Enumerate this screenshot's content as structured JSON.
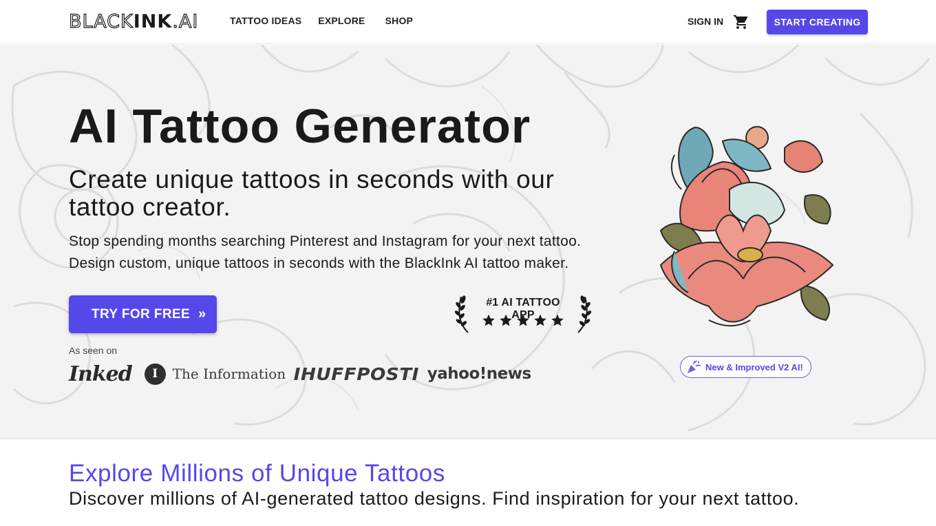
{
  "header": {
    "logo_light": "BLACK",
    "logo_bold": "INK",
    "logo_suffix": ".AI",
    "nav": [
      {
        "label": "TATTOO IDEAS"
      },
      {
        "label": "EXPLORE"
      },
      {
        "label": "SHOP"
      }
    ],
    "sign_in": "SIGN IN",
    "cart_icon": "shopping-cart-icon",
    "start_button": "START CREATING"
  },
  "hero": {
    "title": "AI Tattoo Generator",
    "subtitle": "Create unique tattoos in seconds with our tattoo creator.",
    "description_line1": "Stop spending months searching Pinterest and Instagram for your next tattoo.",
    "description_line2": "Design custom, unique tattoos in seconds with the BlackInk AI tattoo maker.",
    "try_button": "TRY FOR FREE",
    "try_button_icon": "double-chevron-right-icon",
    "seen_on": "As seen on",
    "press": {
      "inked": "Inked",
      "information_mark": "I",
      "information": "The Information",
      "huffpost": "IHUFFPOSTI",
      "yahoo": "yahoo!news"
    },
    "award": {
      "text": "#1 AI TATTOO APP",
      "rating": 5,
      "rating_max": 5
    },
    "badge": "New & Improved V2 AI!",
    "image_alt": "lotus-flower-tattoo"
  },
  "explore": {
    "title": "Explore Millions of Unique Tattoos",
    "subtitle": "Discover millions of AI-generated tattoo designs. Find inspiration for your next tattoo."
  },
  "colors": {
    "accent": "#5548e8",
    "text": "#1a1a1a"
  }
}
